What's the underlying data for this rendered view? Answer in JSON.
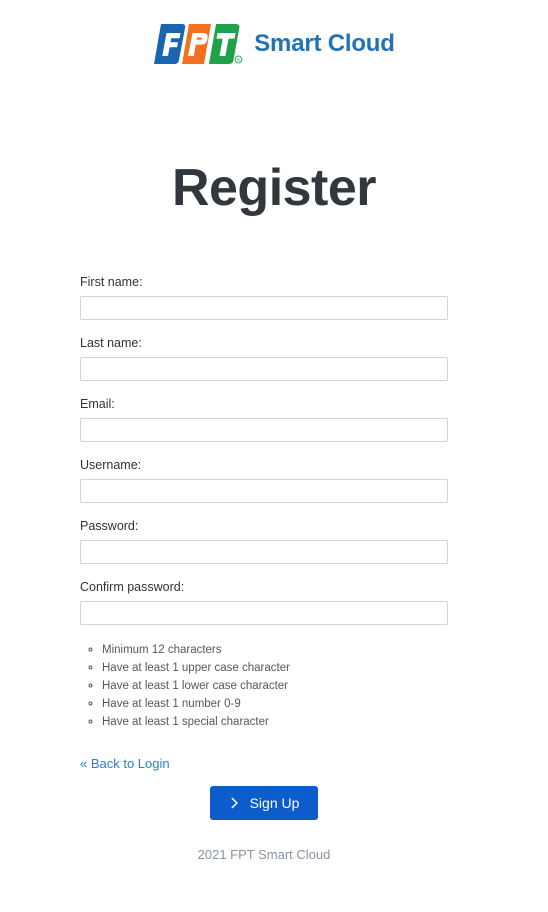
{
  "brand": {
    "logo_icon": "fpt-logo-icon",
    "logo_letters": [
      "F",
      "P",
      "T"
    ],
    "registered_mark": "®",
    "name": "Smart Cloud",
    "colors": {
      "blue": "#1866b0",
      "orange": "#f37021",
      "green": "#20a24a",
      "name_text": "#2272b4"
    }
  },
  "page": {
    "title": "Register"
  },
  "form": {
    "fields": [
      {
        "label": "First name:",
        "value": "",
        "placeholder": "",
        "type": "text",
        "name": "first-name"
      },
      {
        "label": "Last name:",
        "value": "",
        "placeholder": "",
        "type": "text",
        "name": "last-name"
      },
      {
        "label": "Email:",
        "value": "",
        "placeholder": "",
        "type": "text",
        "name": "email"
      },
      {
        "label": "Username:",
        "value": "",
        "placeholder": "",
        "type": "text",
        "name": "username"
      },
      {
        "label": "Password:",
        "value": "",
        "placeholder": "",
        "type": "password",
        "name": "password"
      },
      {
        "label": "Confirm password:",
        "value": "",
        "placeholder": "",
        "type": "password",
        "name": "confirm-password"
      }
    ],
    "password_rules": [
      "Minimum 12 characters",
      "Have at least 1 upper case character",
      "Have at least 1 lower case character",
      "Have at least 1 number 0-9",
      "Have at least 1 special character"
    ],
    "back_link": "« Back to Login",
    "submit": {
      "label": "Sign Up",
      "icon": "chevron-right-icon",
      "color": "#0d5ccb"
    }
  },
  "footer": {
    "text": "2021 FPT Smart Cloud",
    "color": "#8a94a6"
  }
}
